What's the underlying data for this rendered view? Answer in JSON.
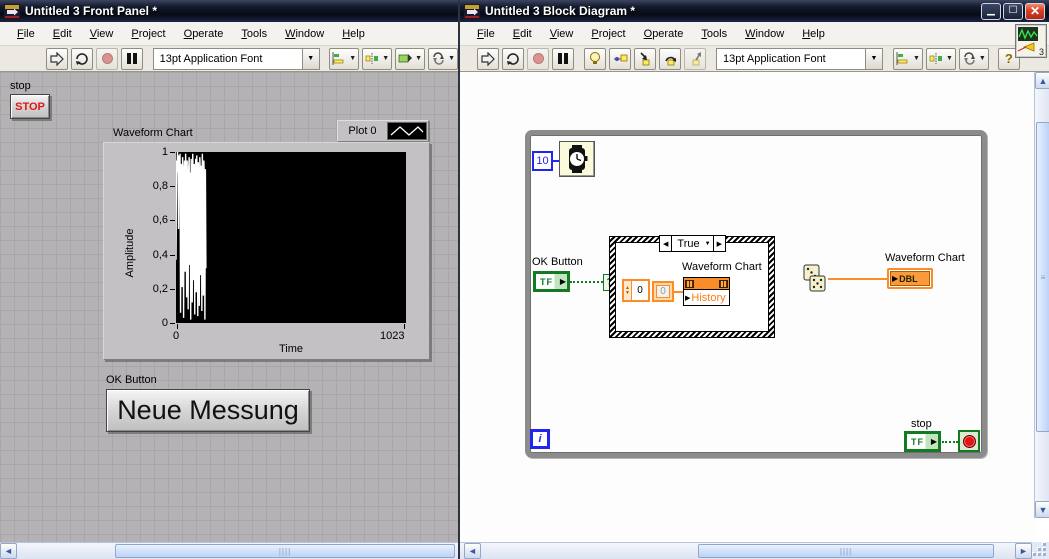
{
  "left_window": {
    "title": "Untitled 3 Front Panel *",
    "menu": [
      "File",
      "Edit",
      "View",
      "Project",
      "Operate",
      "Tools",
      "Window",
      "Help"
    ],
    "toolbar": {
      "font_selector": "13pt Application Font"
    },
    "panel": {
      "stop_label": "stop",
      "stop_button": "STOP",
      "ok_button_label": "OK Button",
      "ok_button_text": "Neue Messung"
    }
  },
  "chart_data": {
    "type": "line",
    "title": "Waveform Chart",
    "xlabel": "Time",
    "ylabel": "Amplitude",
    "xlim": [
      0,
      1023
    ],
    "ylim": [
      0,
      1
    ],
    "x_ticks": [
      "0",
      "1023"
    ],
    "y_ticks": [
      "0",
      "0,2",
      "0,4",
      "0,6",
      "0,8",
      "1"
    ],
    "legend": {
      "label": "Plot 0",
      "position": "top-right"
    },
    "plot_bg": "#000000",
    "line_color": "#ffffff",
    "grid": false,
    "note": "random noise burst occupying roughly the first 13% of the x range, values spanning 0 to 1",
    "series": [
      {
        "name": "Plot 0",
        "x_extent_fraction": 0.13,
        "values": [
          0.37,
          0.95,
          0.88,
          1.0,
          0.92,
          0.55,
          0.98,
          0.85,
          0.99,
          0.06,
          0.93,
          0.88,
          0.21,
          0.97,
          0.9,
          0.03,
          0.86,
          0.95,
          0.3,
          0.99,
          0.82,
          0.15,
          0.95,
          0.65,
          0.08,
          0.9,
          0.97,
          0.34,
          0.88,
          0.02,
          0.96,
          0.7,
          0.12,
          0.99,
          0.85,
          0.25,
          0.93,
          0.05,
          0.89,
          0.96,
          0.18,
          0.98,
          0.8,
          0.04,
          0.94,
          0.6,
          0.1,
          0.97,
          0.87,
          0.28,
          0.92,
          0.07,
          0.99,
          0.75,
          0.16,
          0.95,
          0.83,
          0.02,
          0.9,
          0.32
        ]
      }
    ]
  },
  "right_window": {
    "title": "Untitled 3 Block Diagram *",
    "menu": [
      "File",
      "Edit",
      "View",
      "Project",
      "Operate",
      "Tools",
      "Window",
      "Help"
    ],
    "toolbar": {
      "font_selector": "13pt Application Font",
      "help_label": "?"
    },
    "diagram": {
      "wait_ms_value": "10",
      "ok_button_label": "OK Button",
      "ok_button_terminal": "TF",
      "case_selector_value": "True",
      "array_index_value": "0",
      "array_element_value": "0",
      "property_node_label": "Waveform Chart",
      "property_node_property": "History",
      "chart_terminal_label": "Waveform Chart",
      "chart_terminal_type": "DBL",
      "iteration_terminal": "i",
      "stop_label": "stop",
      "stop_terminal": "TF"
    }
  },
  "colors": {
    "boolean_green": "#117a22",
    "numeric_orange": "#fb8c2a",
    "integer_blue": "#2026f0",
    "abort_red": "#e21414"
  }
}
